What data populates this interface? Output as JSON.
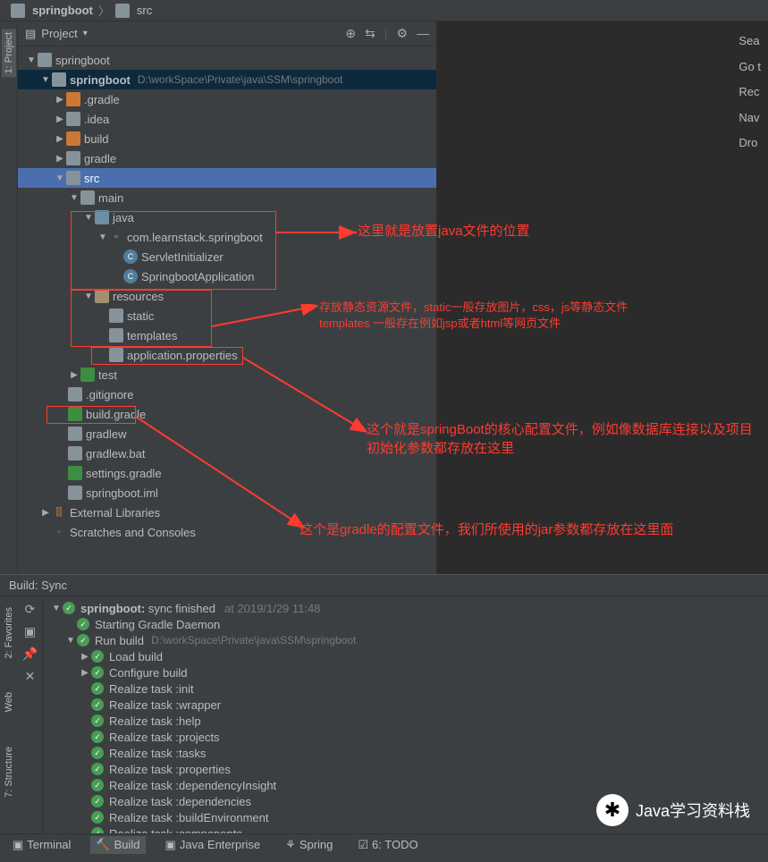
{
  "breadcrumb": {
    "root": "springboot",
    "child": "src"
  },
  "project": {
    "title": "Project",
    "root_hint": "D:\\workSpace\\Private\\java\\SSM\\springboot",
    "nodes": {
      "springboot_top": "springboot",
      "springboot": "springboot",
      "gradle_hidden": ".gradle",
      "idea": ".idea",
      "build": "build",
      "gradle": "gradle",
      "src": "src",
      "main": "main",
      "java": "java",
      "pkg": "com.learnstack.springboot",
      "servlet": "ServletInitializer",
      "app": "SpringbootApplication",
      "resources": "resources",
      "static": "static",
      "templates": "templates",
      "appprops": "application.properties",
      "test": "test",
      "gitignore": ".gitignore",
      "buildgradle": "build.gradle",
      "gradlew": "gradlew",
      "gradlewbat": "gradlew.bat",
      "settingsgradle": "settings.gradle",
      "iml": "springboot.iml",
      "extlib": "External Libraries",
      "scratch": "Scratches and Consoles"
    }
  },
  "search_hints": {
    "l1": "Sea",
    "l2": "Go t",
    "l3": "Rec",
    "l4": "Nav",
    "l5": "Dro"
  },
  "annotations": {
    "a1": "这里就是放置java文件的位置",
    "a2a": "存放静态资源文件，static一般存放图片，css，js等静态文件",
    "a2b": "templates 一般存在例如jsp或者html等网页文件",
    "a3": "这个就是springBoot的核心配置文件，例如像数据库连接以及项目初始化参数都存放在这里",
    "a4": "这个是gradle的配置文件，我们所使用的jar参数都存放在这里面"
  },
  "build": {
    "title": "Build: Sync",
    "root": "springboot:",
    "root_status": "sync finished",
    "root_ts": "at 2019/1/29 11:48",
    "path_hint": "D:\\workSpace\\Private\\java\\SSM\\springboot",
    "items": [
      "Starting Gradle Daemon",
      "Run build",
      "Load build",
      "Configure build",
      "Realize task :init",
      "Realize task :wrapper",
      "Realize task :help",
      "Realize task :projects",
      "Realize task :tasks",
      "Realize task :properties",
      "Realize task :dependencyInsight",
      "Realize task :dependencies",
      "Realize task :buildEnvironment",
      "Realize task :components"
    ]
  },
  "bottom_tabs": {
    "terminal": "Terminal",
    "build": "Build",
    "javaee": "Java Enterprise",
    "spring": "Spring",
    "todo": "6: TODO"
  },
  "left_tabs": {
    "project": "1: Project",
    "favorites": "2: Favorites",
    "web": "Web",
    "structure": "7: Structure"
  },
  "watermark": "Java学习资料栈"
}
